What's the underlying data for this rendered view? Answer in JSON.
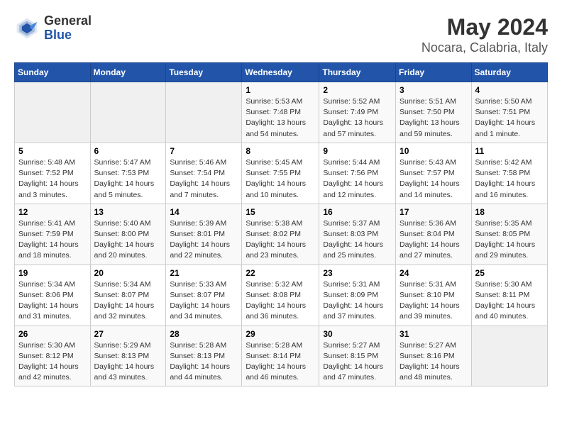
{
  "logo": {
    "general": "General",
    "blue": "Blue"
  },
  "title": "May 2024",
  "subtitle": "Nocara, Calabria, Italy",
  "days_header": [
    "Sunday",
    "Monday",
    "Tuesday",
    "Wednesday",
    "Thursday",
    "Friday",
    "Saturday"
  ],
  "weeks": [
    [
      {
        "day": "",
        "sunrise": "",
        "sunset": "",
        "daylight": "",
        "empty": true
      },
      {
        "day": "",
        "sunrise": "",
        "sunset": "",
        "daylight": "",
        "empty": true
      },
      {
        "day": "",
        "sunrise": "",
        "sunset": "",
        "daylight": "",
        "empty": true
      },
      {
        "day": "1",
        "sunrise": "Sunrise: 5:53 AM",
        "sunset": "Sunset: 7:48 PM",
        "daylight": "Daylight: 13 hours and 54 minutes.",
        "empty": false
      },
      {
        "day": "2",
        "sunrise": "Sunrise: 5:52 AM",
        "sunset": "Sunset: 7:49 PM",
        "daylight": "Daylight: 13 hours and 57 minutes.",
        "empty": false
      },
      {
        "day": "3",
        "sunrise": "Sunrise: 5:51 AM",
        "sunset": "Sunset: 7:50 PM",
        "daylight": "Daylight: 13 hours and 59 minutes.",
        "empty": false
      },
      {
        "day": "4",
        "sunrise": "Sunrise: 5:50 AM",
        "sunset": "Sunset: 7:51 PM",
        "daylight": "Daylight: 14 hours and 1 minute.",
        "empty": false
      }
    ],
    [
      {
        "day": "5",
        "sunrise": "Sunrise: 5:48 AM",
        "sunset": "Sunset: 7:52 PM",
        "daylight": "Daylight: 14 hours and 3 minutes.",
        "empty": false
      },
      {
        "day": "6",
        "sunrise": "Sunrise: 5:47 AM",
        "sunset": "Sunset: 7:53 PM",
        "daylight": "Daylight: 14 hours and 5 minutes.",
        "empty": false
      },
      {
        "day": "7",
        "sunrise": "Sunrise: 5:46 AM",
        "sunset": "Sunset: 7:54 PM",
        "daylight": "Daylight: 14 hours and 7 minutes.",
        "empty": false
      },
      {
        "day": "8",
        "sunrise": "Sunrise: 5:45 AM",
        "sunset": "Sunset: 7:55 PM",
        "daylight": "Daylight: 14 hours and 10 minutes.",
        "empty": false
      },
      {
        "day": "9",
        "sunrise": "Sunrise: 5:44 AM",
        "sunset": "Sunset: 7:56 PM",
        "daylight": "Daylight: 14 hours and 12 minutes.",
        "empty": false
      },
      {
        "day": "10",
        "sunrise": "Sunrise: 5:43 AM",
        "sunset": "Sunset: 7:57 PM",
        "daylight": "Daylight: 14 hours and 14 minutes.",
        "empty": false
      },
      {
        "day": "11",
        "sunrise": "Sunrise: 5:42 AM",
        "sunset": "Sunset: 7:58 PM",
        "daylight": "Daylight: 14 hours and 16 minutes.",
        "empty": false
      }
    ],
    [
      {
        "day": "12",
        "sunrise": "Sunrise: 5:41 AM",
        "sunset": "Sunset: 7:59 PM",
        "daylight": "Daylight: 14 hours and 18 minutes.",
        "empty": false
      },
      {
        "day": "13",
        "sunrise": "Sunrise: 5:40 AM",
        "sunset": "Sunset: 8:00 PM",
        "daylight": "Daylight: 14 hours and 20 minutes.",
        "empty": false
      },
      {
        "day": "14",
        "sunrise": "Sunrise: 5:39 AM",
        "sunset": "Sunset: 8:01 PM",
        "daylight": "Daylight: 14 hours and 22 minutes.",
        "empty": false
      },
      {
        "day": "15",
        "sunrise": "Sunrise: 5:38 AM",
        "sunset": "Sunset: 8:02 PM",
        "daylight": "Daylight: 14 hours and 23 minutes.",
        "empty": false
      },
      {
        "day": "16",
        "sunrise": "Sunrise: 5:37 AM",
        "sunset": "Sunset: 8:03 PM",
        "daylight": "Daylight: 14 hours and 25 minutes.",
        "empty": false
      },
      {
        "day": "17",
        "sunrise": "Sunrise: 5:36 AM",
        "sunset": "Sunset: 8:04 PM",
        "daylight": "Daylight: 14 hours and 27 minutes.",
        "empty": false
      },
      {
        "day": "18",
        "sunrise": "Sunrise: 5:35 AM",
        "sunset": "Sunset: 8:05 PM",
        "daylight": "Daylight: 14 hours and 29 minutes.",
        "empty": false
      }
    ],
    [
      {
        "day": "19",
        "sunrise": "Sunrise: 5:34 AM",
        "sunset": "Sunset: 8:06 PM",
        "daylight": "Daylight: 14 hours and 31 minutes.",
        "empty": false
      },
      {
        "day": "20",
        "sunrise": "Sunrise: 5:34 AM",
        "sunset": "Sunset: 8:07 PM",
        "daylight": "Daylight: 14 hours and 32 minutes.",
        "empty": false
      },
      {
        "day": "21",
        "sunrise": "Sunrise: 5:33 AM",
        "sunset": "Sunset: 8:07 PM",
        "daylight": "Daylight: 14 hours and 34 minutes.",
        "empty": false
      },
      {
        "day": "22",
        "sunrise": "Sunrise: 5:32 AM",
        "sunset": "Sunset: 8:08 PM",
        "daylight": "Daylight: 14 hours and 36 minutes.",
        "empty": false
      },
      {
        "day": "23",
        "sunrise": "Sunrise: 5:31 AM",
        "sunset": "Sunset: 8:09 PM",
        "daylight": "Daylight: 14 hours and 37 minutes.",
        "empty": false
      },
      {
        "day": "24",
        "sunrise": "Sunrise: 5:31 AM",
        "sunset": "Sunset: 8:10 PM",
        "daylight": "Daylight: 14 hours and 39 minutes.",
        "empty": false
      },
      {
        "day": "25",
        "sunrise": "Sunrise: 5:30 AM",
        "sunset": "Sunset: 8:11 PM",
        "daylight": "Daylight: 14 hours and 40 minutes.",
        "empty": false
      }
    ],
    [
      {
        "day": "26",
        "sunrise": "Sunrise: 5:30 AM",
        "sunset": "Sunset: 8:12 PM",
        "daylight": "Daylight: 14 hours and 42 minutes.",
        "empty": false
      },
      {
        "day": "27",
        "sunrise": "Sunrise: 5:29 AM",
        "sunset": "Sunset: 8:13 PM",
        "daylight": "Daylight: 14 hours and 43 minutes.",
        "empty": false
      },
      {
        "day": "28",
        "sunrise": "Sunrise: 5:28 AM",
        "sunset": "Sunset: 8:13 PM",
        "daylight": "Daylight: 14 hours and 44 minutes.",
        "empty": false
      },
      {
        "day": "29",
        "sunrise": "Sunrise: 5:28 AM",
        "sunset": "Sunset: 8:14 PM",
        "daylight": "Daylight: 14 hours and 46 minutes.",
        "empty": false
      },
      {
        "day": "30",
        "sunrise": "Sunrise: 5:27 AM",
        "sunset": "Sunset: 8:15 PM",
        "daylight": "Daylight: 14 hours and 47 minutes.",
        "empty": false
      },
      {
        "day": "31",
        "sunrise": "Sunrise: 5:27 AM",
        "sunset": "Sunset: 8:16 PM",
        "daylight": "Daylight: 14 hours and 48 minutes.",
        "empty": false
      },
      {
        "day": "",
        "sunrise": "",
        "sunset": "",
        "daylight": "",
        "empty": true
      }
    ]
  ]
}
